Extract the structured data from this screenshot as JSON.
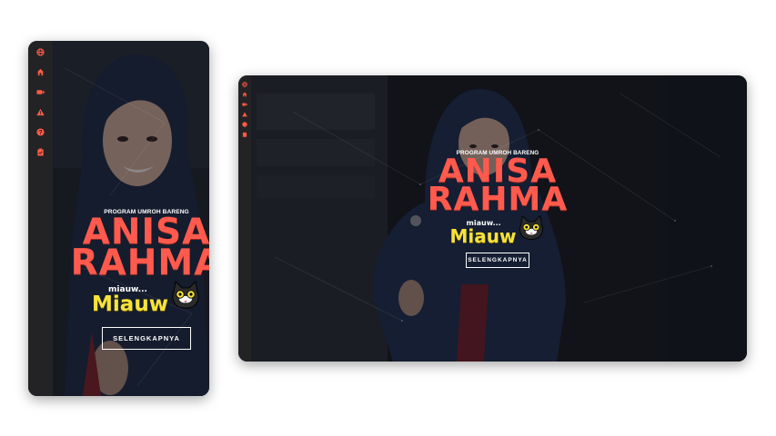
{
  "hero": {
    "eyebrow": "PROGRAM UMROH BARENG",
    "title_line_1": "ANISA",
    "title_line_2": "RAHMA",
    "small_word": "miauw...",
    "big_word": "Miauw",
    "cta_label": "SELENGKAPNYA"
  },
  "sidebar": {
    "icons": [
      "globe-icon",
      "home-icon",
      "video-icon",
      "warning-icon",
      "help-icon",
      "clipboard-icon"
    ]
  },
  "colors": {
    "accent": "#ff5a43",
    "title": "#ff5a4d",
    "logo_yellow": "#f7e23a",
    "sidebar": "#232326",
    "page_bg": "#ffffff"
  }
}
